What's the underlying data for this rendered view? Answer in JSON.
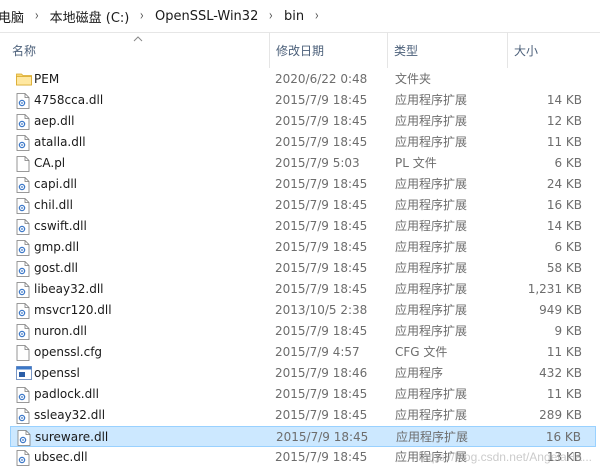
{
  "breadcrumb": [
    "电脑",
    "本地磁盘 (C:)",
    "OpenSSL-Win32",
    "bin"
  ],
  "columns": {
    "name": "名称",
    "date": "修改日期",
    "type": "类型",
    "size": "大小"
  },
  "files": [
    {
      "name": "PEM",
      "date": "2020/6/22 0:48",
      "type": "文件夹",
      "size": "",
      "icon": "folder-icon"
    },
    {
      "name": "4758cca.dll",
      "date": "2015/7/9 18:45",
      "type": "应用程序扩展",
      "size": "14 KB",
      "icon": "dll-icon"
    },
    {
      "name": "aep.dll",
      "date": "2015/7/9 18:45",
      "type": "应用程序扩展",
      "size": "12 KB",
      "icon": "dll-icon"
    },
    {
      "name": "atalla.dll",
      "date": "2015/7/9 18:45",
      "type": "应用程序扩展",
      "size": "11 KB",
      "icon": "dll-icon"
    },
    {
      "name": "CA.pl",
      "date": "2015/7/9 5:03",
      "type": "PL 文件",
      "size": "6 KB",
      "icon": "file-icon"
    },
    {
      "name": "capi.dll",
      "date": "2015/7/9 18:45",
      "type": "应用程序扩展",
      "size": "24 KB",
      "icon": "dll-icon"
    },
    {
      "name": "chil.dll",
      "date": "2015/7/9 18:45",
      "type": "应用程序扩展",
      "size": "16 KB",
      "icon": "dll-icon"
    },
    {
      "name": "cswift.dll",
      "date": "2015/7/9 18:45",
      "type": "应用程序扩展",
      "size": "14 KB",
      "icon": "dll-icon"
    },
    {
      "name": "gmp.dll",
      "date": "2015/7/9 18:45",
      "type": "应用程序扩展",
      "size": "6 KB",
      "icon": "dll-icon"
    },
    {
      "name": "gost.dll",
      "date": "2015/7/9 18:45",
      "type": "应用程序扩展",
      "size": "58 KB",
      "icon": "dll-icon"
    },
    {
      "name": "libeay32.dll",
      "date": "2015/7/9 18:45",
      "type": "应用程序扩展",
      "size": "1,231 KB",
      "icon": "dll-icon"
    },
    {
      "name": "msvcr120.dll",
      "date": "2013/10/5 2:38",
      "type": "应用程序扩展",
      "size": "949 KB",
      "icon": "dll-icon"
    },
    {
      "name": "nuron.dll",
      "date": "2015/7/9 18:45",
      "type": "应用程序扩展",
      "size": "9 KB",
      "icon": "dll-icon"
    },
    {
      "name": "openssl.cfg",
      "date": "2015/7/9 4:57",
      "type": "CFG 文件",
      "size": "11 KB",
      "icon": "file-icon"
    },
    {
      "name": "openssl",
      "date": "2015/7/9 18:46",
      "type": "应用程序",
      "size": "432 KB",
      "icon": "exe-icon"
    },
    {
      "name": "padlock.dll",
      "date": "2015/7/9 18:45",
      "type": "应用程序扩展",
      "size": "11 KB",
      "icon": "dll-icon"
    },
    {
      "name": "ssleay32.dll",
      "date": "2015/7/9 18:45",
      "type": "应用程序扩展",
      "size": "289 KB",
      "icon": "dll-icon"
    },
    {
      "name": "sureware.dll",
      "date": "2015/7/9 18:45",
      "type": "应用程序扩展",
      "size": "16 KB",
      "icon": "dll-icon",
      "selected": true
    },
    {
      "name": "ubsec.dll",
      "date": "2015/7/9 18:45",
      "type": "应用程序扩展",
      "size": "13 KB",
      "icon": "dll-icon"
    }
  ],
  "watermark": "https://blog.csdn.net/AngelaHa...",
  "colors": {
    "selection": "#cce8ff",
    "selection_border": "#99d1ff",
    "header_text": "#4c607a",
    "folder": "#f8d775"
  }
}
